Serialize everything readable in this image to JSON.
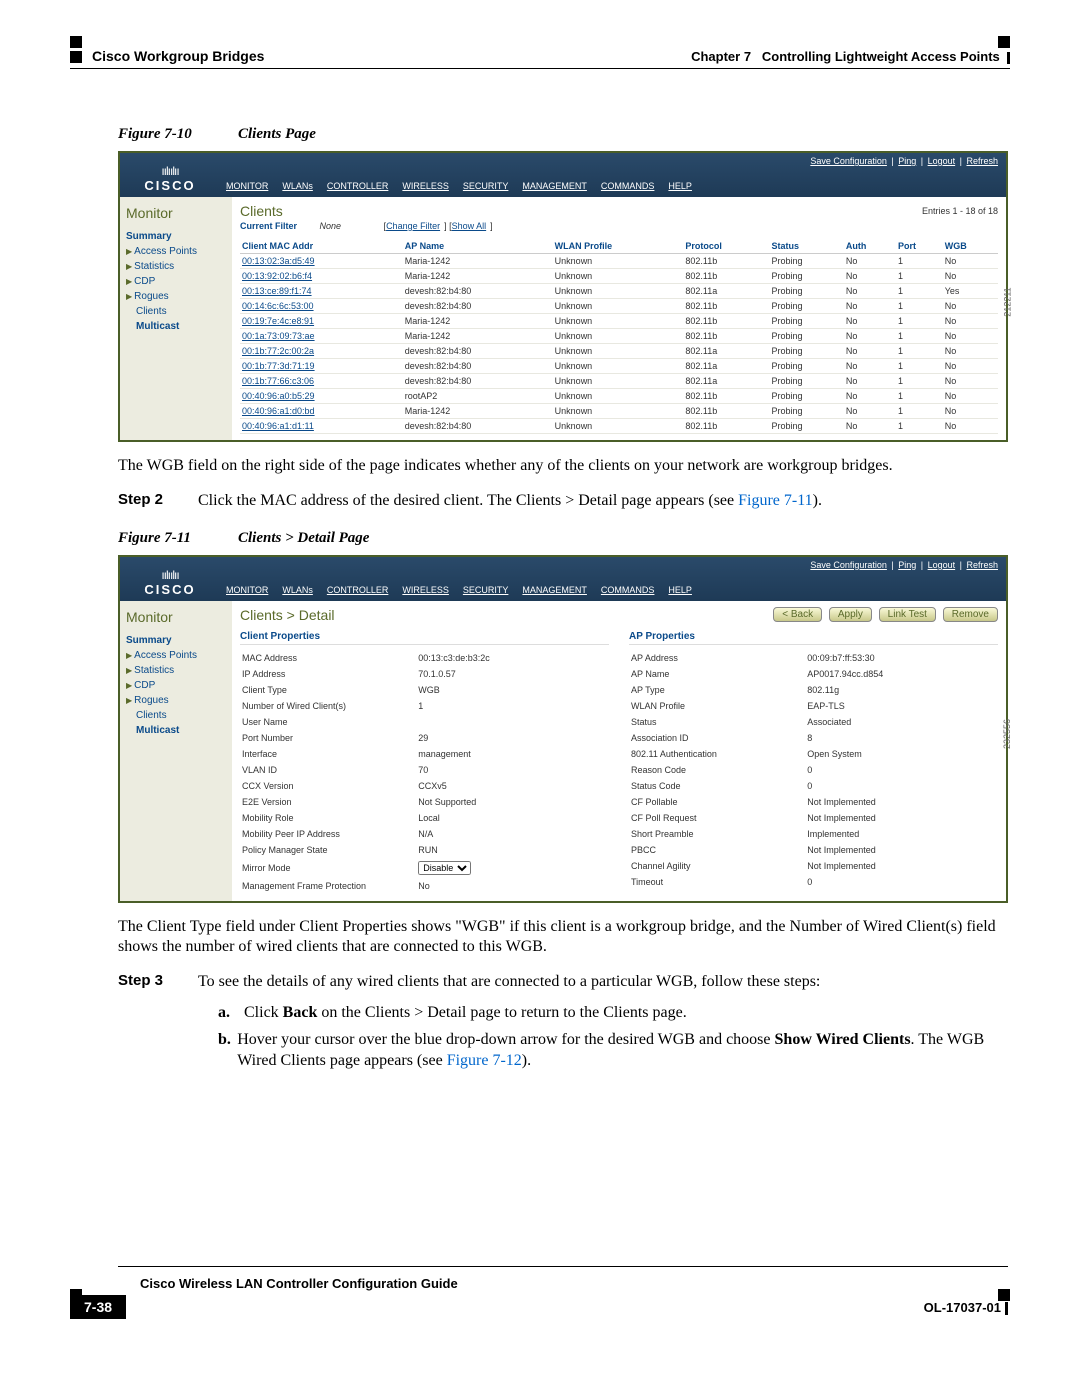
{
  "header": {
    "chapter": "Chapter 7",
    "chapterTitle": "Controlling Lightweight Access Points",
    "section": "Cisco Workgroup Bridges"
  },
  "fig1": {
    "num": "Figure 7-10",
    "title": "Clients Page",
    "imgnum": "212211"
  },
  "fig2": {
    "num": "Figure 7-11",
    "title": "Clients > Detail Page",
    "imgnum": "232556"
  },
  "cisco": {
    "brand": "CISCO"
  },
  "nav": {
    "monitor": "MONITOR",
    "wlans": "WLANs",
    "controller": "CONTROLLER",
    "wireless": "WIRELESS",
    "security": "SECURITY",
    "management": "MANAGEMENT",
    "commands": "COMMANDS",
    "help": "HELP"
  },
  "toplinks": {
    "save": "Save Configuration",
    "ping": "Ping",
    "logout": "Logout",
    "refresh": "Refresh"
  },
  "sidebar": {
    "title": "Monitor",
    "summary": "Summary",
    "ap": "Access Points",
    "stats": "Statistics",
    "cdp": "CDP",
    "rogues": "Rogues",
    "clients": "Clients",
    "multicast": "Multicast"
  },
  "clientsPage": {
    "title": "Clients",
    "entries": "Entries 1 - 18 of 18",
    "filterLbl": "Current Filter",
    "filterNone": "None",
    "changeFilter": "Change Filter",
    "showAll": "Show All"
  },
  "cols": {
    "mac": "Client MAC Addr",
    "ap": "AP Name",
    "wlan": "WLAN Profile",
    "proto": "Protocol",
    "status": "Status",
    "auth": "Auth",
    "port": "Port",
    "wgb": "WGB"
  },
  "rows": [
    {
      "mac": "00:13:02:3a:d5:49",
      "ap": "Maria-1242",
      "wlan": "Unknown",
      "proto": "802.11b",
      "status": "Probing",
      "auth": "No",
      "port": "1",
      "wgb": "No"
    },
    {
      "mac": "00:13:92:02:b6:f4",
      "ap": "Maria-1242",
      "wlan": "Unknown",
      "proto": "802.11b",
      "status": "Probing",
      "auth": "No",
      "port": "1",
      "wgb": "No"
    },
    {
      "mac": "00:13:ce:89:f1:74",
      "ap": "devesh:82:b4:80",
      "wlan": "Unknown",
      "proto": "802.11a",
      "status": "Probing",
      "auth": "No",
      "port": "1",
      "wgb": "Yes"
    },
    {
      "mac": "00:14:6c:6c:53:00",
      "ap": "devesh:82:b4:80",
      "wlan": "Unknown",
      "proto": "802.11b",
      "status": "Probing",
      "auth": "No",
      "port": "1",
      "wgb": "No"
    },
    {
      "mac": "00:19:7e:4c:e8:91",
      "ap": "Maria-1242",
      "wlan": "Unknown",
      "proto": "802.11b",
      "status": "Probing",
      "auth": "No",
      "port": "1",
      "wgb": "No"
    },
    {
      "mac": "00:1a:73:09:73:ae",
      "ap": "Maria-1242",
      "wlan": "Unknown",
      "proto": "802.11b",
      "status": "Probing",
      "auth": "No",
      "port": "1",
      "wgb": "No"
    },
    {
      "mac": "00:1b:77:2c:00:2a",
      "ap": "devesh:82:b4:80",
      "wlan": "Unknown",
      "proto": "802.11a",
      "status": "Probing",
      "auth": "No",
      "port": "1",
      "wgb": "No"
    },
    {
      "mac": "00:1b:77:3d:71:19",
      "ap": "devesh:82:b4:80",
      "wlan": "Unknown",
      "proto": "802.11a",
      "status": "Probing",
      "auth": "No",
      "port": "1",
      "wgb": "No"
    },
    {
      "mac": "00:1b:77:66:c3:06",
      "ap": "devesh:82:b4:80",
      "wlan": "Unknown",
      "proto": "802.11a",
      "status": "Probing",
      "auth": "No",
      "port": "1",
      "wgb": "No"
    },
    {
      "mac": "00:40:96:a0:b5:29",
      "ap": "rootAP2",
      "wlan": "Unknown",
      "proto": "802.11b",
      "status": "Probing",
      "auth": "No",
      "port": "1",
      "wgb": "No"
    },
    {
      "mac": "00:40:96:a1:d0:bd",
      "ap": "Maria-1242",
      "wlan": "Unknown",
      "proto": "802.11b",
      "status": "Probing",
      "auth": "No",
      "port": "1",
      "wgb": "No"
    },
    {
      "mac": "00:40:96:a1:d1:11",
      "ap": "devesh:82:b4:80",
      "wlan": "Unknown",
      "proto": "802.11b",
      "status": "Probing",
      "auth": "No",
      "port": "1",
      "wgb": "No"
    }
  ],
  "para1": "The WGB field on the right side of the page indicates whether any of the clients on your network are workgroup bridges.",
  "step2": {
    "label": "Step 2",
    "text_a": "Click the MAC address of the desired client. The Clients > Detail page appears (see ",
    "figref": "Figure 7-11",
    "text_b": ")."
  },
  "detail": {
    "title": "Clients > Detail",
    "back": "< Back",
    "apply": "Apply",
    "linktest": "Link Test",
    "remove": "Remove",
    "clientHd": "Client Properties",
    "apHd": "AP Properties",
    "cp": [
      [
        "MAC Address",
        "00:13:c3:de:b3:2c"
      ],
      [
        "IP Address",
        "70.1.0.57"
      ],
      [
        "Client Type",
        "WGB"
      ],
      [
        "Number of Wired Client(s)",
        "1"
      ],
      [
        "User Name",
        ""
      ],
      [
        "Port Number",
        "29"
      ],
      [
        "Interface",
        "management"
      ],
      [
        "VLAN ID",
        "70"
      ],
      [
        "CCX Version",
        "CCXv5"
      ],
      [
        "E2E Version",
        "Not Supported"
      ],
      [
        "Mobility Role",
        "Local"
      ],
      [
        "Mobility Peer IP Address",
        "N/A"
      ],
      [
        "Policy Manager State",
        "RUN"
      ],
      [
        "Mirror Mode",
        "Disable"
      ],
      [
        "Management Frame Protection",
        "No"
      ]
    ],
    "ap": [
      [
        "AP Address",
        "00:09:b7:ff:53:30"
      ],
      [
        "AP Name",
        "AP0017.94cc.d854"
      ],
      [
        "AP Type",
        "802.11g"
      ],
      [
        "WLAN Profile",
        "EAP-TLS"
      ],
      [
        "Status",
        "Associated"
      ],
      [
        "Association ID",
        "8"
      ],
      [
        "802.11 Authentication",
        "Open System"
      ],
      [
        "Reason Code",
        "0"
      ],
      [
        "Status Code",
        "0"
      ],
      [
        "CF Pollable",
        "Not Implemented"
      ],
      [
        "CF Poll Request",
        "Not Implemented"
      ],
      [
        "Short Preamble",
        "Implemented"
      ],
      [
        "PBCC",
        "Not Implemented"
      ],
      [
        "Channel Agility",
        "Not Implemented"
      ],
      [
        "Timeout",
        "0"
      ]
    ]
  },
  "para2": "The Client Type field under Client Properties shows \"WGB\" if this client is a workgroup bridge, and the Number of Wired Client(s) field shows the number of wired clients that are connected to this WGB.",
  "step3": {
    "label": "Step 3",
    "text": "To see the details of any wired clients that are connected to a particular WGB, follow these steps:"
  },
  "sub_a": {
    "let": "a.",
    "t1": "Click ",
    "b": "Back",
    "t2": " on the Clients > Detail page to return to the Clients page."
  },
  "sub_b": {
    "let": "b.",
    "t1": "Hover your cursor over the blue drop-down arrow for the desired WGB and choose ",
    "b": "Show Wired Clients",
    "t2": ". The WGB Wired Clients page appears (see ",
    "figref": "Figure 7-12",
    "t3": ")."
  },
  "footer": {
    "guide": "Cisco Wireless LAN Controller Configuration Guide",
    "pagenum": "7-38",
    "ol": "OL-17037-01"
  }
}
